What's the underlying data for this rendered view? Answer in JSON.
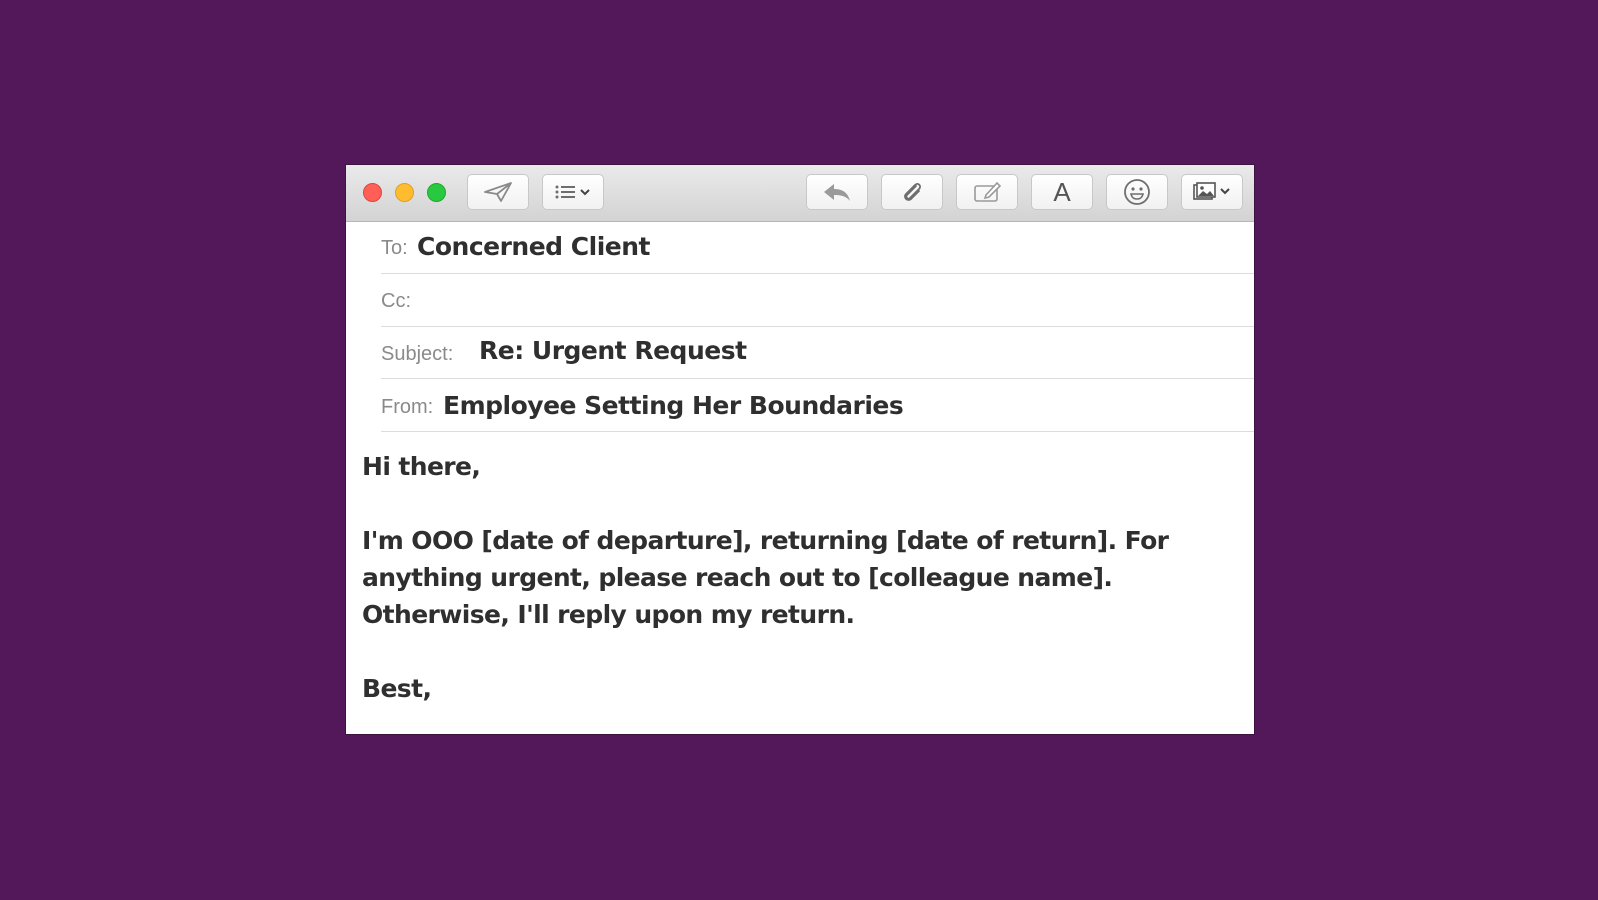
{
  "window": {
    "toolbar": {
      "send": {
        "icon": "paper-plane-icon"
      },
      "header_fields": {
        "icon": "list-icon"
      },
      "reply": {
        "icon": "reply-arrow-icon"
      },
      "attach": {
        "icon": "paperclip-icon"
      },
      "markup": {
        "icon": "markup-pen-icon"
      },
      "format": {
        "label": "A",
        "icon": "font-icon"
      },
      "emoji": {
        "icon": "smiley-icon"
      },
      "photo": {
        "icon": "photo-browser-icon"
      }
    },
    "to": {
      "label": "To:",
      "value": "Concerned Client"
    },
    "cc": {
      "label": "Cc:",
      "value": ""
    },
    "subject": {
      "label": "Subject:",
      "value": "Re: Urgent Request"
    },
    "from": {
      "label": "From:",
      "value": "Employee Setting Her Boundaries"
    },
    "body": {
      "greeting": "Hi there,",
      "line1": "I'm OOO [date of departure], returning [date of return]. For",
      "line2": "anything urgent, please reach out to [colleague name].",
      "line3": "Otherwise, I'll reply upon my return.",
      "signoff": "Best,"
    }
  },
  "colors": {
    "background": "#53185a",
    "close": "#ff5f57",
    "minimize": "#febc2e",
    "maximize": "#28c840"
  }
}
